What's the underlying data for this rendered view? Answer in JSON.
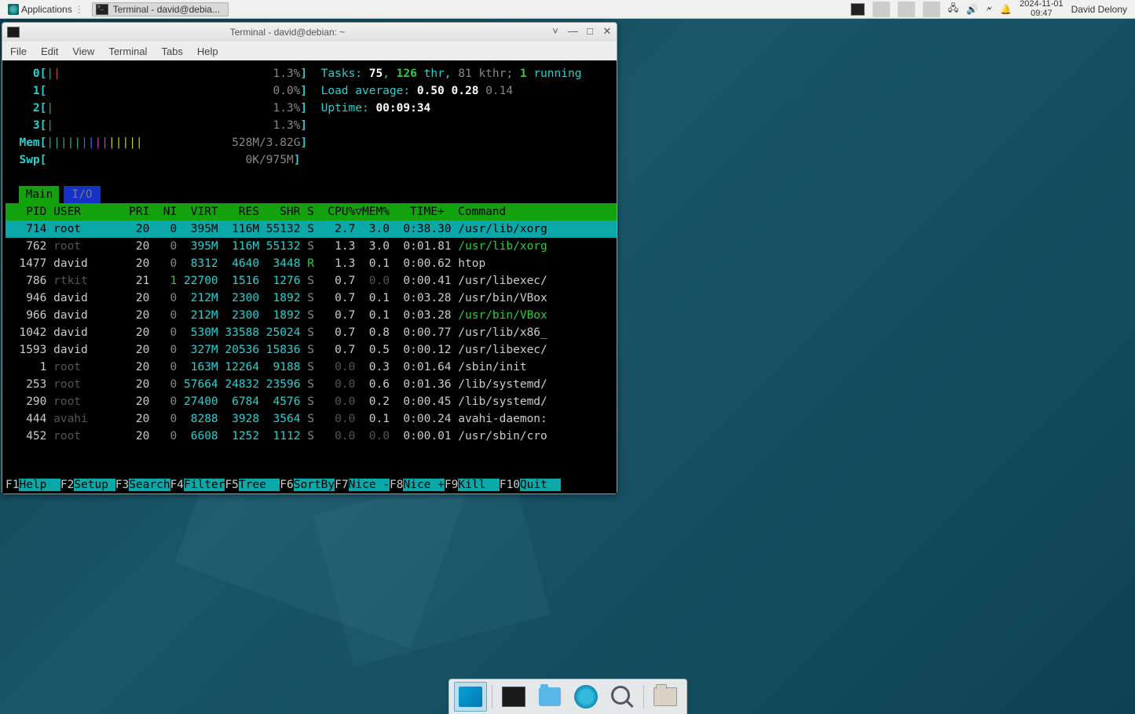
{
  "panel": {
    "applications": "Applications",
    "task": "Terminal - david@debia...",
    "date": "2024-11-01",
    "time": "09:47",
    "user": "David Delony"
  },
  "window": {
    "title": "Terminal - david@debian: ~",
    "menus": [
      "File",
      "Edit",
      "View",
      "Terminal",
      "Tabs",
      "Help"
    ]
  },
  "meters": {
    "cpu": [
      {
        "label": "0",
        "pct": "1.3%"
      },
      {
        "label": "1",
        "pct": "0.0%"
      },
      {
        "label": "2",
        "pct": "1.3%"
      },
      {
        "label": "3",
        "pct": "1.3%"
      }
    ],
    "mem_label": "Mem",
    "mem_val": "528M/3.82G",
    "swp_label": "Swp",
    "swp_val": "0K/975M",
    "tasks_label": "Tasks:",
    "tasks_procs": "75",
    "tasks_thr": "126",
    "tasks_thr_lbl": " thr,",
    "tasks_kthr": "81 kthr;",
    "tasks_running": "1",
    "tasks_running_lbl": "running",
    "load_label": "Load average:",
    "load1": "0.50",
    "load2": "0.28",
    "load3": "0.14",
    "uptime_label": "Uptime:",
    "uptime_val": "00:09:34"
  },
  "tabs": {
    "main": "Main",
    "io": "I/O"
  },
  "headers": "   PID USER       PRI  NI  VIRT   RES   SHR S  CPU%▽MEM%   TIME+  Command",
  "rows": [
    {
      "pid": "714",
      "user": "root",
      "pri": "20",
      "ni": "0",
      "virt": "395M",
      "res": "116M",
      "shr": "55132",
      "s": "S",
      "cpu": "2.7",
      "mem": "3.0",
      "time": "0:38.30",
      "cmd": "/usr/lib/xorg",
      "sel": true
    },
    {
      "pid": "762",
      "user": "root",
      "pri": "20",
      "ni": "0",
      "virt": "395M",
      "res": "116M",
      "shr": "55132",
      "s": "S",
      "cpu": "1.3",
      "mem": "3.0",
      "time": "0:01.81",
      "cmd": "/usr/lib/xorg",
      "dim": true,
      "cmdgreen": true
    },
    {
      "pid": "1477",
      "user": "david",
      "pri": "20",
      "ni": "0",
      "virt": "8312",
      "res": "4640",
      "shr": "3448",
      "s": "R",
      "cpu": "1.3",
      "mem": "0.1",
      "time": "0:00.62",
      "cmd": "htop",
      "running": true
    },
    {
      "pid": "786",
      "user": "rtkit",
      "pri": "21",
      "ni": "1",
      "virt": "22700",
      "res": "1516",
      "shr": "1276",
      "s": "S",
      "cpu": "0.7",
      "mem": "0.0",
      "time": "0:00.41",
      "cmd": "/usr/libexec/",
      "dim": true,
      "nigreen": true,
      "memgrey": true
    },
    {
      "pid": "946",
      "user": "david",
      "pri": "20",
      "ni": "0",
      "virt": "212M",
      "res": "2300",
      "shr": "1892",
      "s": "S",
      "cpu": "0.7",
      "mem": "0.1",
      "time": "0:03.28",
      "cmd": "/usr/bin/VBox"
    },
    {
      "pid": "966",
      "user": "david",
      "pri": "20",
      "ni": "0",
      "virt": "212M",
      "res": "2300",
      "shr": "1892",
      "s": "S",
      "cpu": "0.7",
      "mem": "0.1",
      "time": "0:03.28",
      "cmd": "/usr/bin/VBox",
      "cmdgreen": true
    },
    {
      "pid": "1042",
      "user": "david",
      "pri": "20",
      "ni": "0",
      "virt": "530M",
      "res": "33588",
      "shr": "25024",
      "s": "S",
      "cpu": "0.7",
      "mem": "0.8",
      "time": "0:00.77",
      "cmd": "/usr/lib/x86_"
    },
    {
      "pid": "1593",
      "user": "david",
      "pri": "20",
      "ni": "0",
      "virt": "327M",
      "res": "20536",
      "shr": "15836",
      "s": "S",
      "cpu": "0.7",
      "mem": "0.5",
      "time": "0:00.12",
      "cmd": "/usr/libexec/"
    },
    {
      "pid": "1",
      "user": "root",
      "pri": "20",
      "ni": "0",
      "virt": "163M",
      "res": "12264",
      "shr": "9188",
      "s": "S",
      "cpu": "0.0",
      "mem": "0.3",
      "time": "0:01.64",
      "cmd": "/sbin/init",
      "dim": true,
      "cpugrey": true
    },
    {
      "pid": "253",
      "user": "root",
      "pri": "20",
      "ni": "0",
      "virt": "57664",
      "res": "24832",
      "shr": "23596",
      "s": "S",
      "cpu": "0.0",
      "mem": "0.6",
      "time": "0:01.36",
      "cmd": "/lib/systemd/",
      "dim": true,
      "cpugrey": true
    },
    {
      "pid": "290",
      "user": "root",
      "pri": "20",
      "ni": "0",
      "virt": "27400",
      "res": "6784",
      "shr": "4576",
      "s": "S",
      "cpu": "0.0",
      "mem": "0.2",
      "time": "0:00.45",
      "cmd": "/lib/systemd/",
      "dim": true,
      "cpugrey": true
    },
    {
      "pid": "444",
      "user": "avahi",
      "pri": "20",
      "ni": "0",
      "virt": "8288",
      "res": "3928",
      "shr": "3564",
      "s": "S",
      "cpu": "0.0",
      "mem": "0.1",
      "time": "0:00.24",
      "cmd": "avahi-daemon:",
      "dim": true,
      "cpugrey": true
    },
    {
      "pid": "452",
      "user": "root",
      "pri": "20",
      "ni": "0",
      "virt": "6608",
      "res": "1252",
      "shr": "1112",
      "s": "S",
      "cpu": "0.0",
      "mem": "0.0",
      "time": "0:00.01",
      "cmd": "/usr/sbin/cro",
      "dim": true,
      "cpugrey": true,
      "memgrey": true
    }
  ],
  "fkeys": [
    {
      "k": "F1",
      "l": "Help  "
    },
    {
      "k": "F2",
      "l": "Setup "
    },
    {
      "k": "F3",
      "l": "Search"
    },
    {
      "k": "F4",
      "l": "Filter"
    },
    {
      "k": "F5",
      "l": "Tree  "
    },
    {
      "k": "F6",
      "l": "SortBy"
    },
    {
      "k": "F7",
      "l": "Nice -"
    },
    {
      "k": "F8",
      "l": "Nice +"
    },
    {
      "k": "F9",
      "l": "Kill  "
    },
    {
      "k": "F10",
      "l": "Quit  "
    }
  ]
}
